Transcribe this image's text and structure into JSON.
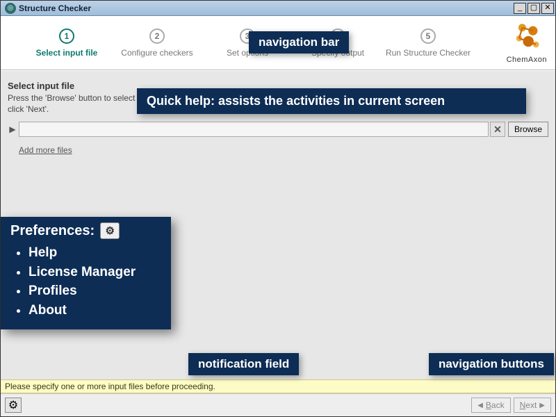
{
  "window": {
    "title": "Structure Checker"
  },
  "brand": {
    "name": "ChemAxon"
  },
  "steps": [
    {
      "number": "1",
      "label": "Select input file",
      "active": true
    },
    {
      "number": "2",
      "label": "Configure checkers",
      "active": false
    },
    {
      "number": "3",
      "label": "Set options",
      "active": false
    },
    {
      "number": "4",
      "label": "Specify output",
      "active": false
    },
    {
      "number": "5",
      "label": "Run Structure Checker",
      "active": false
    }
  ],
  "main": {
    "heading": "Select input file",
    "help_text": "Press the 'Browse' button to select an input file, or drag and drop a file onto the input field. After you have specified a valid path to your file, click 'Next'.",
    "file_value": "",
    "browse_label": "Browse",
    "add_more_label": "Add more files"
  },
  "annotations": {
    "nav_bar": "navigation bar",
    "quick_help": "Quick help: assists the activities in current screen",
    "notification_field": "notification field",
    "nav_buttons": "navigation buttons",
    "preferences": {
      "title": "Preferences:",
      "items": [
        "Help",
        "License Manager",
        "Profiles",
        "About"
      ]
    }
  },
  "notification": {
    "message": "Please specify one or more input files before proceeding."
  },
  "footer": {
    "back_underline": "B",
    "back_rest": "ack",
    "next_underline": "N",
    "next_rest": "ext"
  }
}
